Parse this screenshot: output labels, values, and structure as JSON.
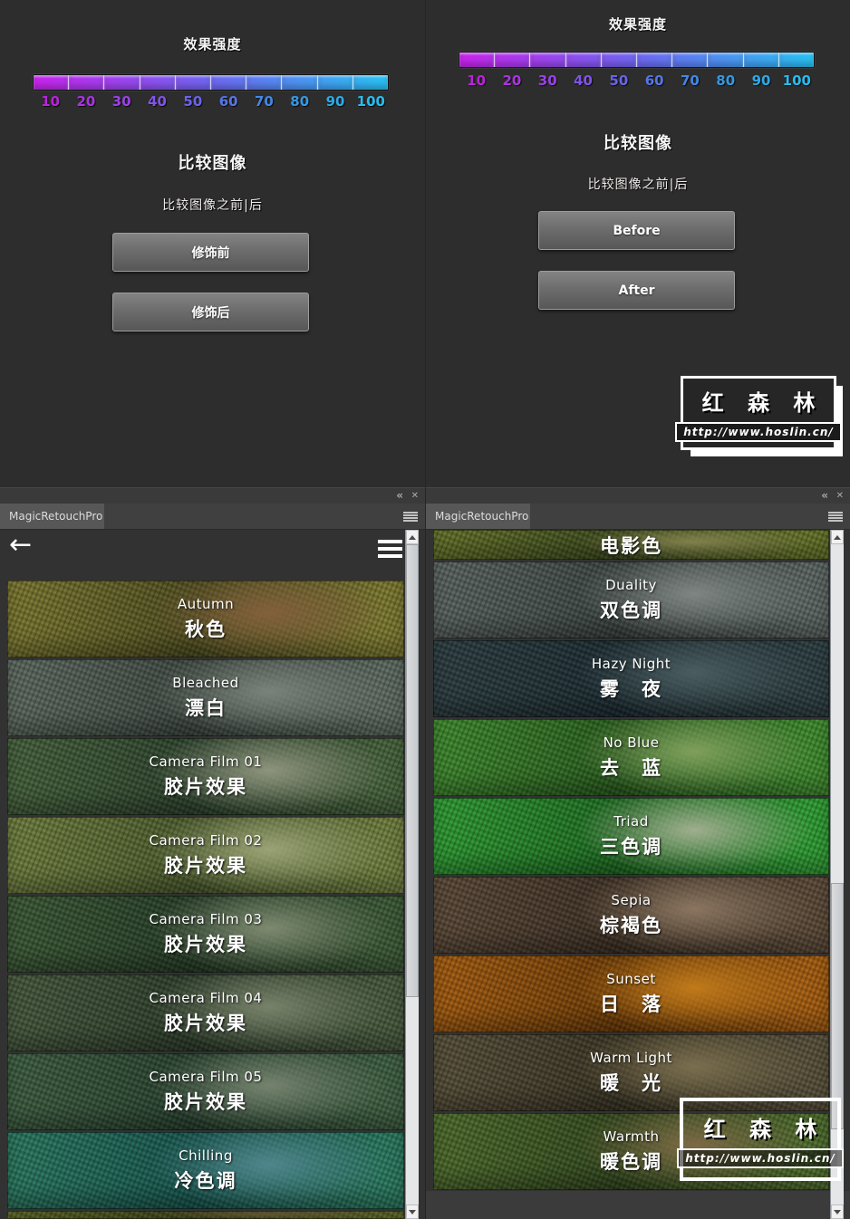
{
  "strength": {
    "title": "效果强度",
    "bar_colors": {
      "start": "#c624ea",
      "mid": "#6f66f0",
      "end": "#29c0f2"
    },
    "ticks": [
      {
        "label": "10",
        "color": "#bb22dd"
      },
      {
        "label": "20",
        "color": "#ab34e0"
      },
      {
        "label": "30",
        "color": "#9a42e5"
      },
      {
        "label": "40",
        "color": "#8153e8"
      },
      {
        "label": "50",
        "color": "#6a64e8"
      },
      {
        "label": "60",
        "color": "#5576e6"
      },
      {
        "label": "70",
        "color": "#4487e4"
      },
      {
        "label": "80",
        "color": "#3598e2"
      },
      {
        "label": "90",
        "color": "#2fa9e6"
      },
      {
        "label": "100",
        "color": "#28bcee"
      }
    ]
  },
  "compare": {
    "title": "比较图像",
    "subtitle": "比较图像之前|后"
  },
  "buttons_left": {
    "before": "修饰前",
    "after": "修饰后"
  },
  "buttons_right": {
    "before": "Before",
    "after": "After"
  },
  "watermark": {
    "name": "红 森 林",
    "url": "http://www.hoslin.cn/"
  },
  "panel": {
    "tab": "MagicRetouchPro",
    "collapse_icon": "«",
    "close_icon": "✕"
  },
  "left_list": {
    "items": [
      {
        "en": "Autumn",
        "zh": "秋色",
        "c1": "#7d7a30",
        "c2": "#4e4d1f",
        "rock": "#82603c"
      },
      {
        "en": "Bleached",
        "zh": "漂白",
        "c1": "#5e6b61",
        "c2": "#3d4740",
        "rock": "#79837a"
      },
      {
        "en": "Camera Film 01",
        "zh": "胶片效果",
        "c1": "#46633c",
        "c2": "#2c422c",
        "rock": "#8e947e"
      },
      {
        "en": "Camera Film 02",
        "zh": "胶片效果",
        "c1": "#70803f",
        "c2": "#4a5a2c",
        "rock": "#9aa375"
      },
      {
        "en": "Camera Film 03",
        "zh": "胶片效果",
        "c1": "#3c5a36",
        "c2": "#253c26",
        "rock": "#7d8a70"
      },
      {
        "en": "Camera Film 04",
        "zh": "胶片效果",
        "c1": "#475a3e",
        "c2": "#2c3c2a",
        "rock": "#78826a"
      },
      {
        "en": "Camera Film 05",
        "zh": "胶片效果",
        "c1": "#3e5f41",
        "c2": "#27402e",
        "rock": "#74836e"
      },
      {
        "en": "Chilling",
        "zh": "冷色调",
        "c1": "#2a7a60",
        "c2": "#16554e",
        "rock": "#4f868c"
      }
    ],
    "partial_bottom": {
      "c1": "#6d7a2e",
      "c2": "#4a541f",
      "rock": "#7a6a40"
    }
  },
  "right_list": {
    "partial_top": {
      "zh": "电影色",
      "c1": "#68762a",
      "c2": "#3c4a1e",
      "rock": "#8a8a52"
    },
    "items": [
      {
        "en": "Duality",
        "zh": "双色调",
        "c1": "#5c6663",
        "c2": "#3a433f",
        "rock": "#7e8583"
      },
      {
        "en": "Hazy Night",
        "zh": "雾　夜",
        "c1": "#2c3e42",
        "c2": "#1b2b31",
        "rock": "#4a5c60"
      },
      {
        "en": "No Blue",
        "zh": "去　蓝",
        "c1": "#3f8c2e",
        "c2": "#285c1d",
        "rock": "#7fa05c"
      },
      {
        "en": "Triad",
        "zh": "三色调",
        "c1": "#2f9e33",
        "c2": "#1d6b20",
        "rock": "#9fae8e"
      },
      {
        "en": "Sepia",
        "zh": "棕褐色",
        "c1": "#5c4a38",
        "c2": "#3c2f23",
        "rock": "#8a7560"
      },
      {
        "en": "Sunset",
        "zh": "日　落",
        "c1": "#a65d0f",
        "c2": "#6e3c06",
        "rock": "#c07a1a"
      },
      {
        "en": "Warm Light",
        "zh": "暖　光",
        "c1": "#58503a",
        "c2": "#383322",
        "rock": "#7a6e4e"
      },
      {
        "en": "Warmth",
        "zh": "暖色调",
        "c1": "#4e6d2c",
        "c2": "#31481d",
        "rock": "#7c6a45"
      }
    ]
  }
}
